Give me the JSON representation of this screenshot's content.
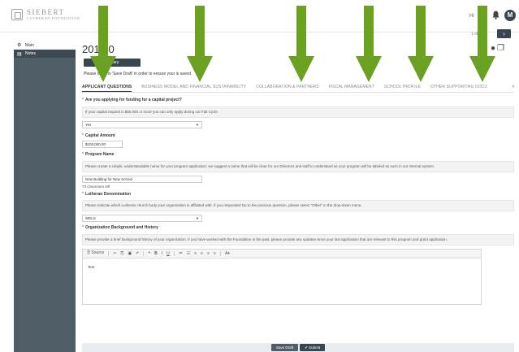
{
  "header": {
    "logo_main": "SIEBERT",
    "logo_sub": "LUTHERAN FOUNDATION",
    "user_name": "Hi",
    "avatar_initial": "M"
  },
  "pager": {
    "text": "1 of",
    "next_label": "›"
  },
  "sidebar": {
    "items": [
      {
        "label": "Main",
        "icon": "gear-icon"
      },
      {
        "label": "Notes",
        "icon": "notes-icon"
      }
    ]
  },
  "page": {
    "title": "201     50",
    "summary_button": "Summary",
    "save_note": "Please      mber to 'Save Draft' in order to ensure your      is saved."
  },
  "tabs": [
    {
      "label": "APPLICANT QUESTIONS",
      "active": true
    },
    {
      "label": "BUSINESS MODEL AND FINANCIAL SUSTAINABILITY",
      "active": false
    },
    {
      "label": "COLLABORATION & PARTNERS",
      "active": false
    },
    {
      "label": "FISCAL MANAGEMENT",
      "active": false
    },
    {
      "label": "SCHOOL PROFILE",
      "active": false
    },
    {
      "label": "OTHER SUPPORTING DOCU",
      "active": false
    }
  ],
  "form": {
    "q1": {
      "label": "Are you applying for funding for a capital project?",
      "help": "If your capital request is $50,000 or more you can only apply during our Fall Cycle.",
      "value": "Yes"
    },
    "q2": {
      "label": "Capital Amount",
      "value": "$100,000.00"
    },
    "q3": {
      "label": "Program Name",
      "help": "Please create a simple, understandable name for your program application; we suggest a name that will be clear for our Directors and staff to understand as your program will be labeled as such in our internal system.",
      "value": "New Building for New School",
      "chars_left": "73 characters left"
    },
    "q4": {
      "label": "Lutheran Denomination",
      "help": "Please indicate which Lutheran church body your organization is affiliated with. If you responded No to the previous question, please select \"Other\" in the drop-down menu.",
      "value": "WELS"
    },
    "q5": {
      "label": "Organization Background and History",
      "help": "Please provide a brief background history of your organization. If you have worked with the Foundation in the past, please provide any updates since your last application that are relevant to this program and grant application.",
      "editor_source": "Source",
      "editor_text": "Test"
    }
  },
  "footer": {
    "save_draft": "Save Draft",
    "submit": "✔ Submit"
  },
  "colors": {
    "arrow": "#6aa121",
    "sidebar": "#4f5d66",
    "dark_button": "#37474f"
  }
}
